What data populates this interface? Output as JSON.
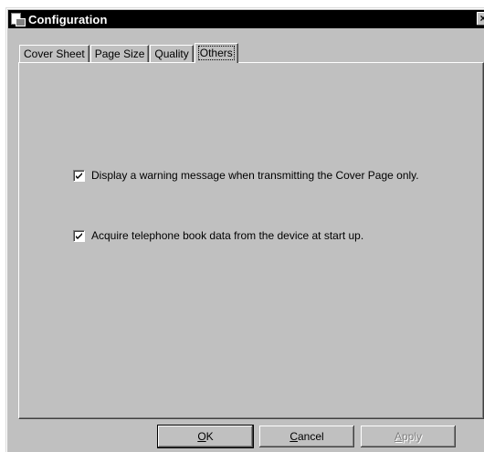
{
  "window": {
    "title": "Configuration",
    "app_icon": "configuration-app-icon",
    "close_glyph": "×"
  },
  "tabs": [
    {
      "label": "Cover Sheet",
      "active": false
    },
    {
      "label": "Page Size",
      "active": false
    },
    {
      "label": "Quality",
      "active": false
    },
    {
      "label": "Others",
      "active": true
    }
  ],
  "options": [
    {
      "label": "Display a warning message when transmitting the Cover Page only.",
      "checked": true
    },
    {
      "label": "Acquire telephone book data from the device at start up.",
      "checked": true
    }
  ],
  "buttons": {
    "ok": {
      "mnemonic": "O",
      "rest": "K",
      "enabled": true
    },
    "cancel": {
      "mnemonic": "C",
      "rest": "ancel",
      "enabled": true
    },
    "apply": {
      "mnemonic": "A",
      "rest": "pply",
      "enabled": false
    }
  },
  "colors": {
    "face": "#c0c0c0",
    "titlebar": "#000000",
    "disabled_text": "#808080"
  }
}
